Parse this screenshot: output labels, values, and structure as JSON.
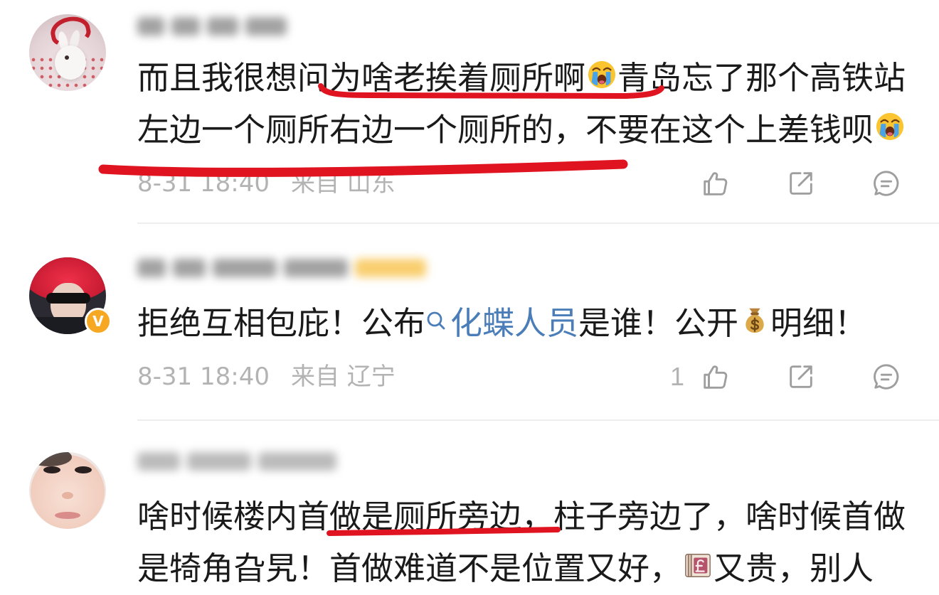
{
  "colors": {
    "text": "#1a1a1a",
    "meta_text": "#b3b3b3",
    "action_icon": "#9e9e9e",
    "link": "#4b7db8",
    "annotation_red": "#e01420",
    "divider": "#eeeeee",
    "verified_badge": "#f7a823",
    "background": "#ffffff"
  },
  "action_icons": {
    "like": "thumbs-up-icon",
    "share": "share-icon",
    "comment": "comment-icon"
  },
  "comments": [
    {
      "line1": {
        "text_before_emoji": "而且我很想问为啥老挨着厕所啊",
        "emoji": "loudly-crying-face",
        "text_after_emoji": "青岛忘了那个高铁站"
      },
      "line2": {
        "text_before_emoji": "左边一个厕所右边一个厕所的，不要在这个上差钱呗",
        "emoji": "loudly-crying-face"
      },
      "date": "8-31 18:40",
      "location": "来自 山东"
    },
    {
      "verified_badge": "V",
      "line1": {
        "text_before_link": "拒绝互相包庇！公布",
        "link_icon": "search-icon",
        "link_text": "化蝶人员",
        "text_after_link": "是谁！公开",
        "emoji": "money-bag",
        "text_after_emoji": "明细！"
      },
      "date": "8-31 18:40",
      "location": "来自 辽宁",
      "like_count": "1"
    },
    {
      "line1": {
        "text": "啥时候楼内首做是厕所旁边，柱子旁边了，啥时候首做"
      },
      "line2": {
        "text_before_emoji": "是犄角旮旯！首做难道不是位置又好，",
        "emoji": "pound-banknote",
        "text_after_emoji": "又贵，别人"
      }
    }
  ]
}
